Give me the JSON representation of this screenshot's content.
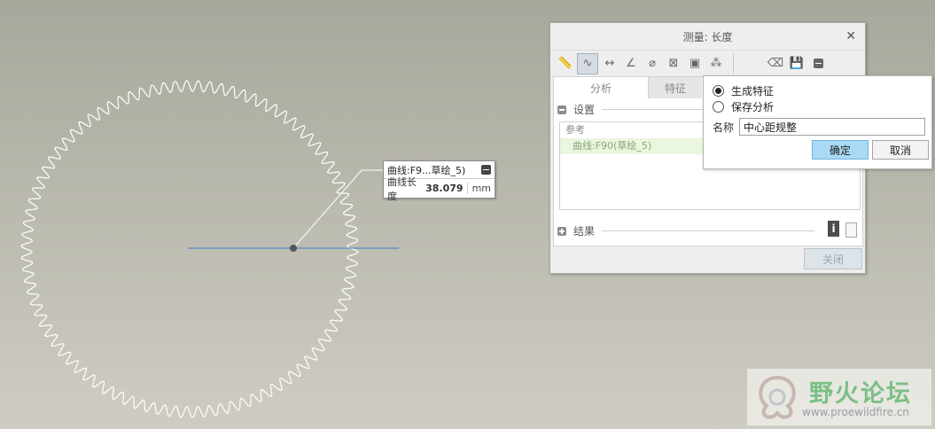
{
  "callout": {
    "title": "曲线:F9...草绘_5)",
    "label": "曲线长度",
    "value": "38.079",
    "unit": "mm"
  },
  "dialog": {
    "title": "测量: 长度",
    "tabs": [
      "分析",
      "特征"
    ],
    "settings_label": "设置",
    "ref_header": "参考",
    "ref_item": "曲线:F90(草绘_5)",
    "results_label": "结果",
    "close_label": "关闭",
    "toolbar_icons": [
      "ruler-icon",
      "length-curve-icon",
      "distance-icon",
      "angle-icon",
      "diameter-icon",
      "area-icon",
      "volume-icon",
      "transform-icon",
      "eraser-icon",
      "save-icon",
      "collapse-icon"
    ]
  },
  "popup": {
    "option_generate": "生成特征",
    "option_save": "保存分析",
    "name_label": "名称",
    "name_value": "中心距规整",
    "ok_label": "确定",
    "cancel_label": "取消"
  },
  "watermark": {
    "title": "野火论坛",
    "url": "www.proewildfire.cn"
  },
  "colors": {
    "gear": "#ffffff",
    "axis": "#3a7fd0",
    "accent": "#a9d9f5"
  }
}
